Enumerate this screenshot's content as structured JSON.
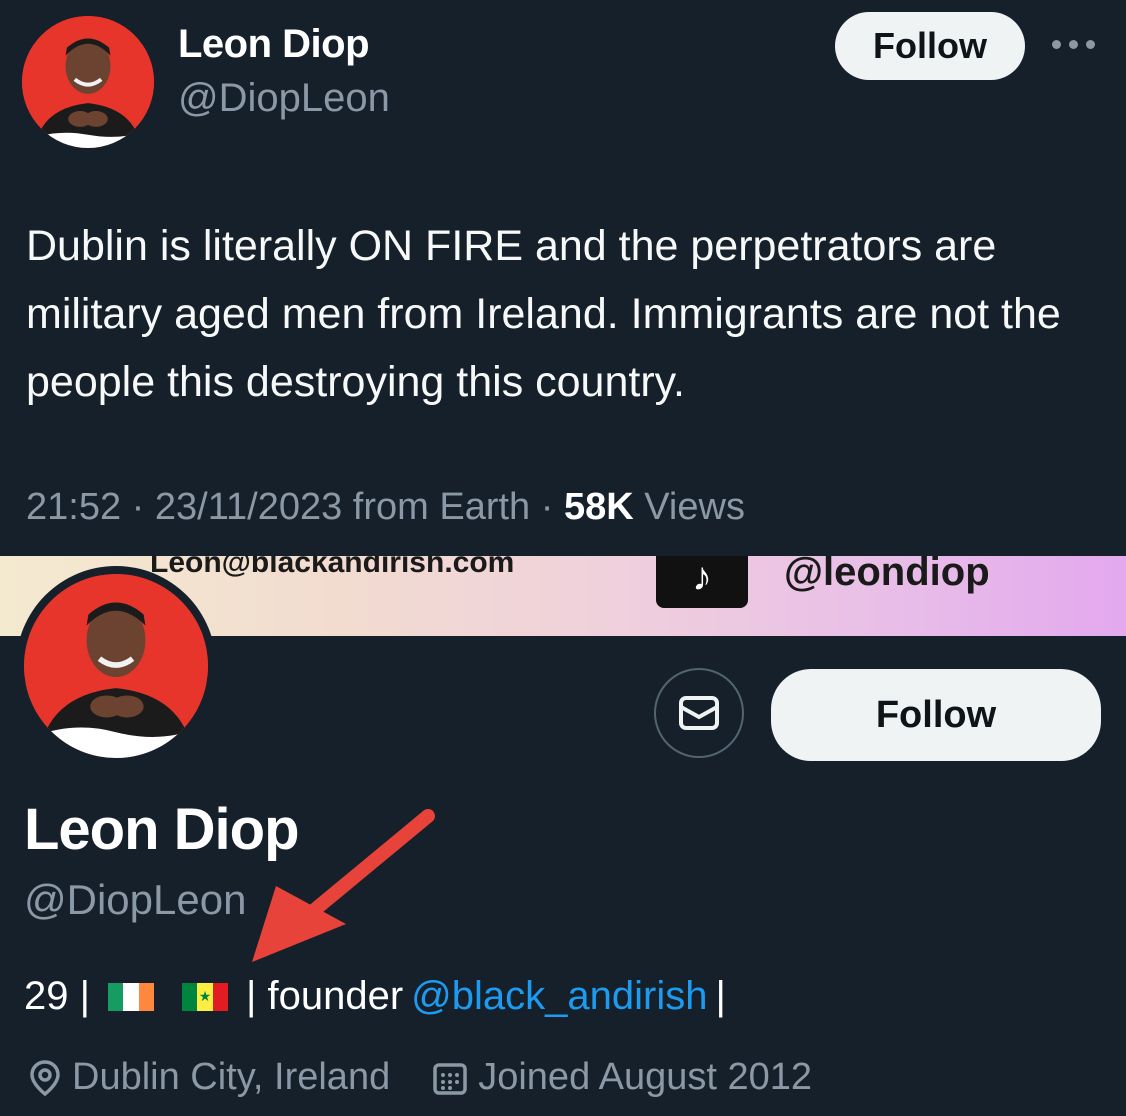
{
  "tweet": {
    "display_name": "Leon Diop",
    "handle": "@DiopLeon",
    "follow_label": "Follow",
    "more_icon": "more-horizontal-icon",
    "text": "Dublin is literally ON FIRE and the perpetrators are military aged men from Ireland. Immigrants are not the people this destroying this country.",
    "time": "21:52",
    "sep1": " · ",
    "date": "23/11/2023",
    "source": " from Earth",
    "sep2": " · ",
    "views_count": "58K",
    "views_label": " Views"
  },
  "profile": {
    "banner_email": "Leon@blackandirish.com",
    "banner_tiktok_handle": "@leondiop",
    "message_icon": "envelope-icon",
    "follow_label": "Follow",
    "display_name": "Leon Diop",
    "handle": "@DiopLeon",
    "bio": {
      "age": "29 |",
      "flag_ireland": "ireland-flag",
      "flag_senegal": "senegal-flag",
      "founder_text": "| founder",
      "mention": "@black_andirish",
      "trailing": "|"
    },
    "location": "Dublin City, Ireland",
    "joined": "Joined August 2012"
  },
  "colors": {
    "background": "#15202b",
    "secondary_text": "#8b98a5",
    "link": "#1d9bf0",
    "follow_bg": "#eff3f4",
    "annotation_arrow": "#e8433a"
  }
}
